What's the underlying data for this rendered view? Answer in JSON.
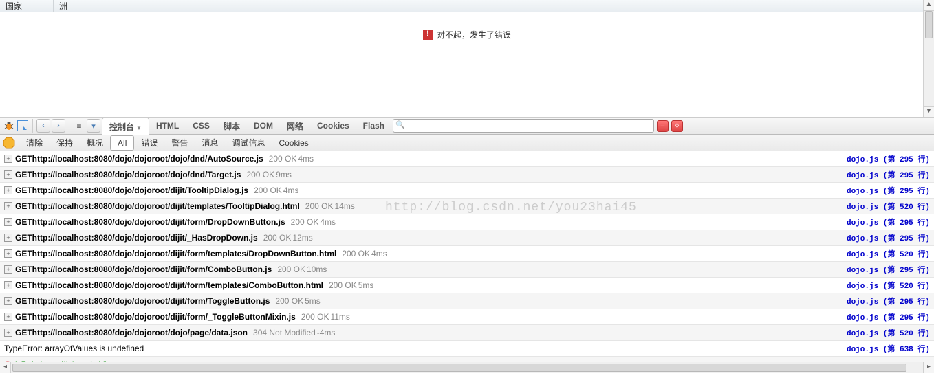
{
  "top": {
    "headers": [
      "国家",
      "洲"
    ],
    "error_text": "对不起，发生了错误"
  },
  "firebug": {
    "nav_back": "‹",
    "nav_fwd": "›",
    "tabs": [
      "控制台",
      "HTML",
      "CSS",
      "脚本",
      "DOM",
      "网络",
      "Cookies",
      "Flash"
    ],
    "active_tab": 0,
    "search_placeholder": "",
    "subbar": [
      "清除",
      "保持",
      "概况",
      "All",
      "错误",
      "警告",
      "消息",
      "调试信息",
      "Cookies"
    ],
    "active_sub": 3
  },
  "watermark": "http://blog.csdn.net/you23hai45",
  "requests": [
    {
      "method": "GET",
      "url": "http://localhost:8080/dojo/dojoroot/dojo/dnd/AutoSource.js",
      "status": "200 OK",
      "time": "4ms",
      "source": "dojo.js (第 295 行)"
    },
    {
      "method": "GET",
      "url": "http://localhost:8080/dojo/dojoroot/dojo/dnd/Target.js",
      "status": "200 OK",
      "time": "9ms",
      "source": "dojo.js (第 295 行)"
    },
    {
      "method": "GET",
      "url": "http://localhost:8080/dojo/dojoroot/dijit/TooltipDialog.js",
      "status": "200 OK",
      "time": "4ms",
      "source": "dojo.js (第 295 行)"
    },
    {
      "method": "GET",
      "url": "http://localhost:8080/dojo/dojoroot/dijit/templates/TooltipDialog.html",
      "status": "200 OK",
      "time": "14ms",
      "source": "dojo.js (第 520 行)"
    },
    {
      "method": "GET",
      "url": "http://localhost:8080/dojo/dojoroot/dijit/form/DropDownButton.js",
      "status": "200 OK",
      "time": "4ms",
      "source": "dojo.js (第 295 行)"
    },
    {
      "method": "GET",
      "url": "http://localhost:8080/dojo/dojoroot/dijit/_HasDropDown.js",
      "status": "200 OK",
      "time": "12ms",
      "source": "dojo.js (第 295 行)"
    },
    {
      "method": "GET",
      "url": "http://localhost:8080/dojo/dojoroot/dijit/form/templates/DropDownButton.html",
      "status": "200 OK",
      "time": "4ms",
      "source": "dojo.js (第 520 行)"
    },
    {
      "method": "GET",
      "url": "http://localhost:8080/dojo/dojoroot/dijit/form/ComboButton.js",
      "status": "200 OK",
      "time": "10ms",
      "source": "dojo.js (第 295 行)"
    },
    {
      "method": "GET",
      "url": "http://localhost:8080/dojo/dojoroot/dijit/form/templates/ComboButton.html",
      "status": "200 OK",
      "time": "5ms",
      "source": "dojo.js (第 520 行)"
    },
    {
      "method": "GET",
      "url": "http://localhost:8080/dojo/dojoroot/dijit/form/ToggleButton.js",
      "status": "200 OK",
      "time": "5ms",
      "source": "dojo.js (第 295 行)"
    },
    {
      "method": "GET",
      "url": "http://localhost:8080/dojo/dojoroot/dijit/form/_ToggleButtonMixin.js",
      "status": "200 OK",
      "time": "11ms",
      "source": "dojo.js (第 295 行)"
    },
    {
      "method": "GET",
      "url": "http://localhost:8080/dojo/dojoroot/dojo/page/data.json",
      "status": "304 Not Modified",
      "time": "-4ms",
      "source": "dojo.js (第 520 行)"
    }
  ],
  "error_line": {
    "text": "TypeError: arrayOfValues is undefined",
    "source": "dojo.js (第 638 行)"
  },
  "code_line": "isRelative = /^\\./.test(mid);"
}
